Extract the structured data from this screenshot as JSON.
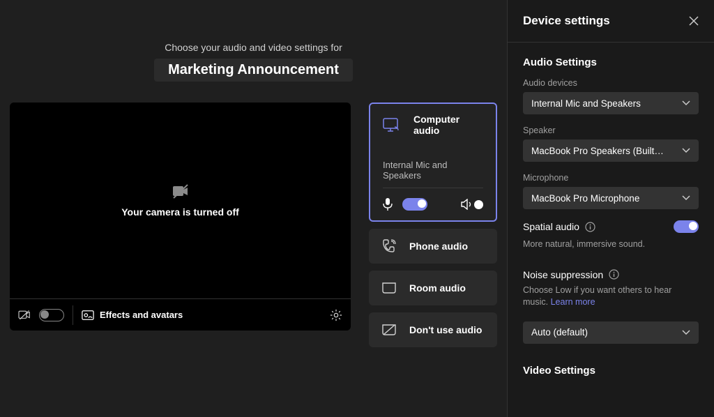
{
  "header": {
    "subtitle": "Choose your audio and video settings for",
    "meeting_name": "Marketing Announcement"
  },
  "video": {
    "off_text": "Your camera is turned off",
    "effects_label": "Effects and avatars"
  },
  "audio_options": {
    "computer": "Computer audio",
    "device_line": "Internal Mic and Speakers",
    "phone": "Phone audio",
    "room": "Room audio",
    "none": "Don't use audio"
  },
  "settings": {
    "title": "Device settings",
    "audio_section": "Audio Settings",
    "audio_devices_label": "Audio devices",
    "audio_devices_value": "Internal Mic and Speakers",
    "speaker_label": "Speaker",
    "speaker_value": "MacBook Pro Speakers (Built…",
    "mic_label": "Microphone",
    "mic_value": "MacBook Pro Microphone",
    "spatial_label": "Spatial audio",
    "spatial_desc": "More natural, immersive sound.",
    "noise_label": "Noise suppression",
    "noise_desc": "Choose Low if you want others to hear music. ",
    "learn_more": "Learn more",
    "noise_value": "Auto (default)",
    "video_section": "Video Settings"
  }
}
